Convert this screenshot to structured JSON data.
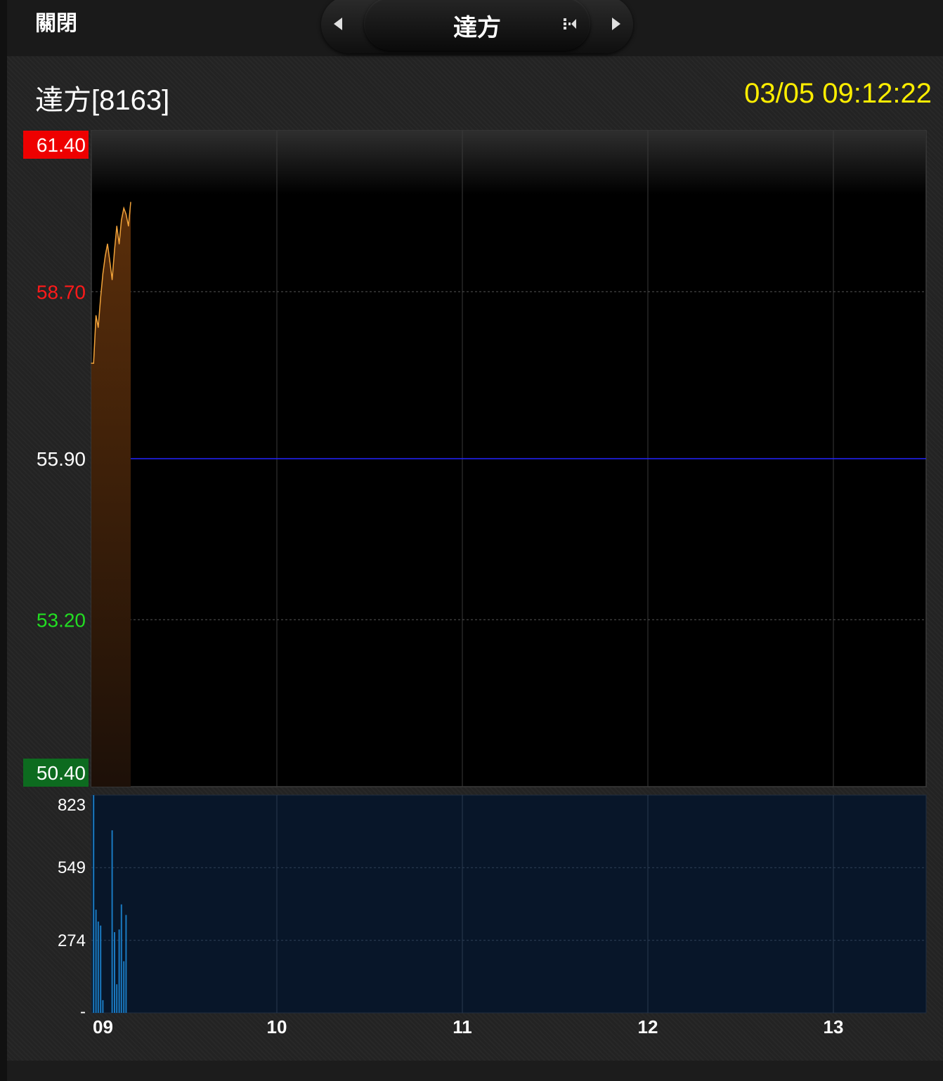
{
  "header": {
    "close_label": "關閉",
    "nav_title": "達方",
    "icons": {
      "prev": "chevron-left-icon",
      "next": "chevron-right-icon",
      "switch": "switch-icon"
    }
  },
  "stock": {
    "title": "達方[8163]",
    "timestamp": "03/05 09:12:22"
  },
  "colors": {
    "up": "#ff1a1a",
    "down": "#22dd22",
    "limit_up_bg": "#ee0000",
    "limit_down_bg": "#0d6b1f",
    "price_line": "#f2a33a",
    "ref_line": "#2222ff",
    "volume": "#1a79c0",
    "timestamp": "#ffee00"
  },
  "chart_data": [
    {
      "type": "area",
      "name": "price",
      "x_ticks": [
        "09",
        "10",
        "11",
        "12",
        "13"
      ],
      "xlim": [
        9.0,
        13.5
      ],
      "ylim": [
        50.4,
        61.4
      ],
      "y_ticks": [
        {
          "value": 61.4,
          "label": "61.40",
          "style": "limit-up"
        },
        {
          "value": 58.7,
          "label": "58.70",
          "style": "up"
        },
        {
          "value": 55.9,
          "label": "55.90",
          "style": "ref"
        },
        {
          "value": 53.2,
          "label": "53.20",
          "style": "down"
        },
        {
          "value": 50.4,
          "label": "50.40",
          "style": "limit-down"
        }
      ],
      "reference": 55.9,
      "x": [
        9.0,
        9.012,
        9.025,
        9.037,
        9.05,
        9.062,
        9.075,
        9.087,
        9.1,
        9.112,
        9.125,
        9.137,
        9.15,
        9.162,
        9.175,
        9.187,
        9.2,
        9.212
      ],
      "values": [
        57.5,
        57.5,
        58.3,
        58.1,
        58.6,
        59.0,
        59.3,
        59.5,
        59.2,
        58.9,
        59.4,
        59.8,
        59.5,
        59.9,
        60.1,
        60.0,
        59.8,
        60.2
      ],
      "grid": true
    },
    {
      "type": "bar",
      "name": "volume",
      "xlim": [
        9.0,
        13.5
      ],
      "ylim": [
        0,
        823
      ],
      "y_ticks": [
        {
          "value": 823,
          "label": "823"
        },
        {
          "value": 549,
          "label": "549"
        },
        {
          "value": 274,
          "label": "274"
        },
        {
          "value": 0,
          "label": "-"
        }
      ],
      "x": [
        9.012,
        9.025,
        9.037,
        9.05,
        9.062,
        9.075,
        9.087,
        9.1,
        9.112,
        9.125,
        9.137,
        9.15,
        9.162,
        9.175,
        9.187,
        9.2,
        9.212
      ],
      "values": [
        823,
        390,
        345,
        330,
        48,
        0,
        0,
        0,
        690,
        305,
        108,
        315,
        410,
        195,
        370,
        0,
        0
      ],
      "grid": true
    }
  ]
}
